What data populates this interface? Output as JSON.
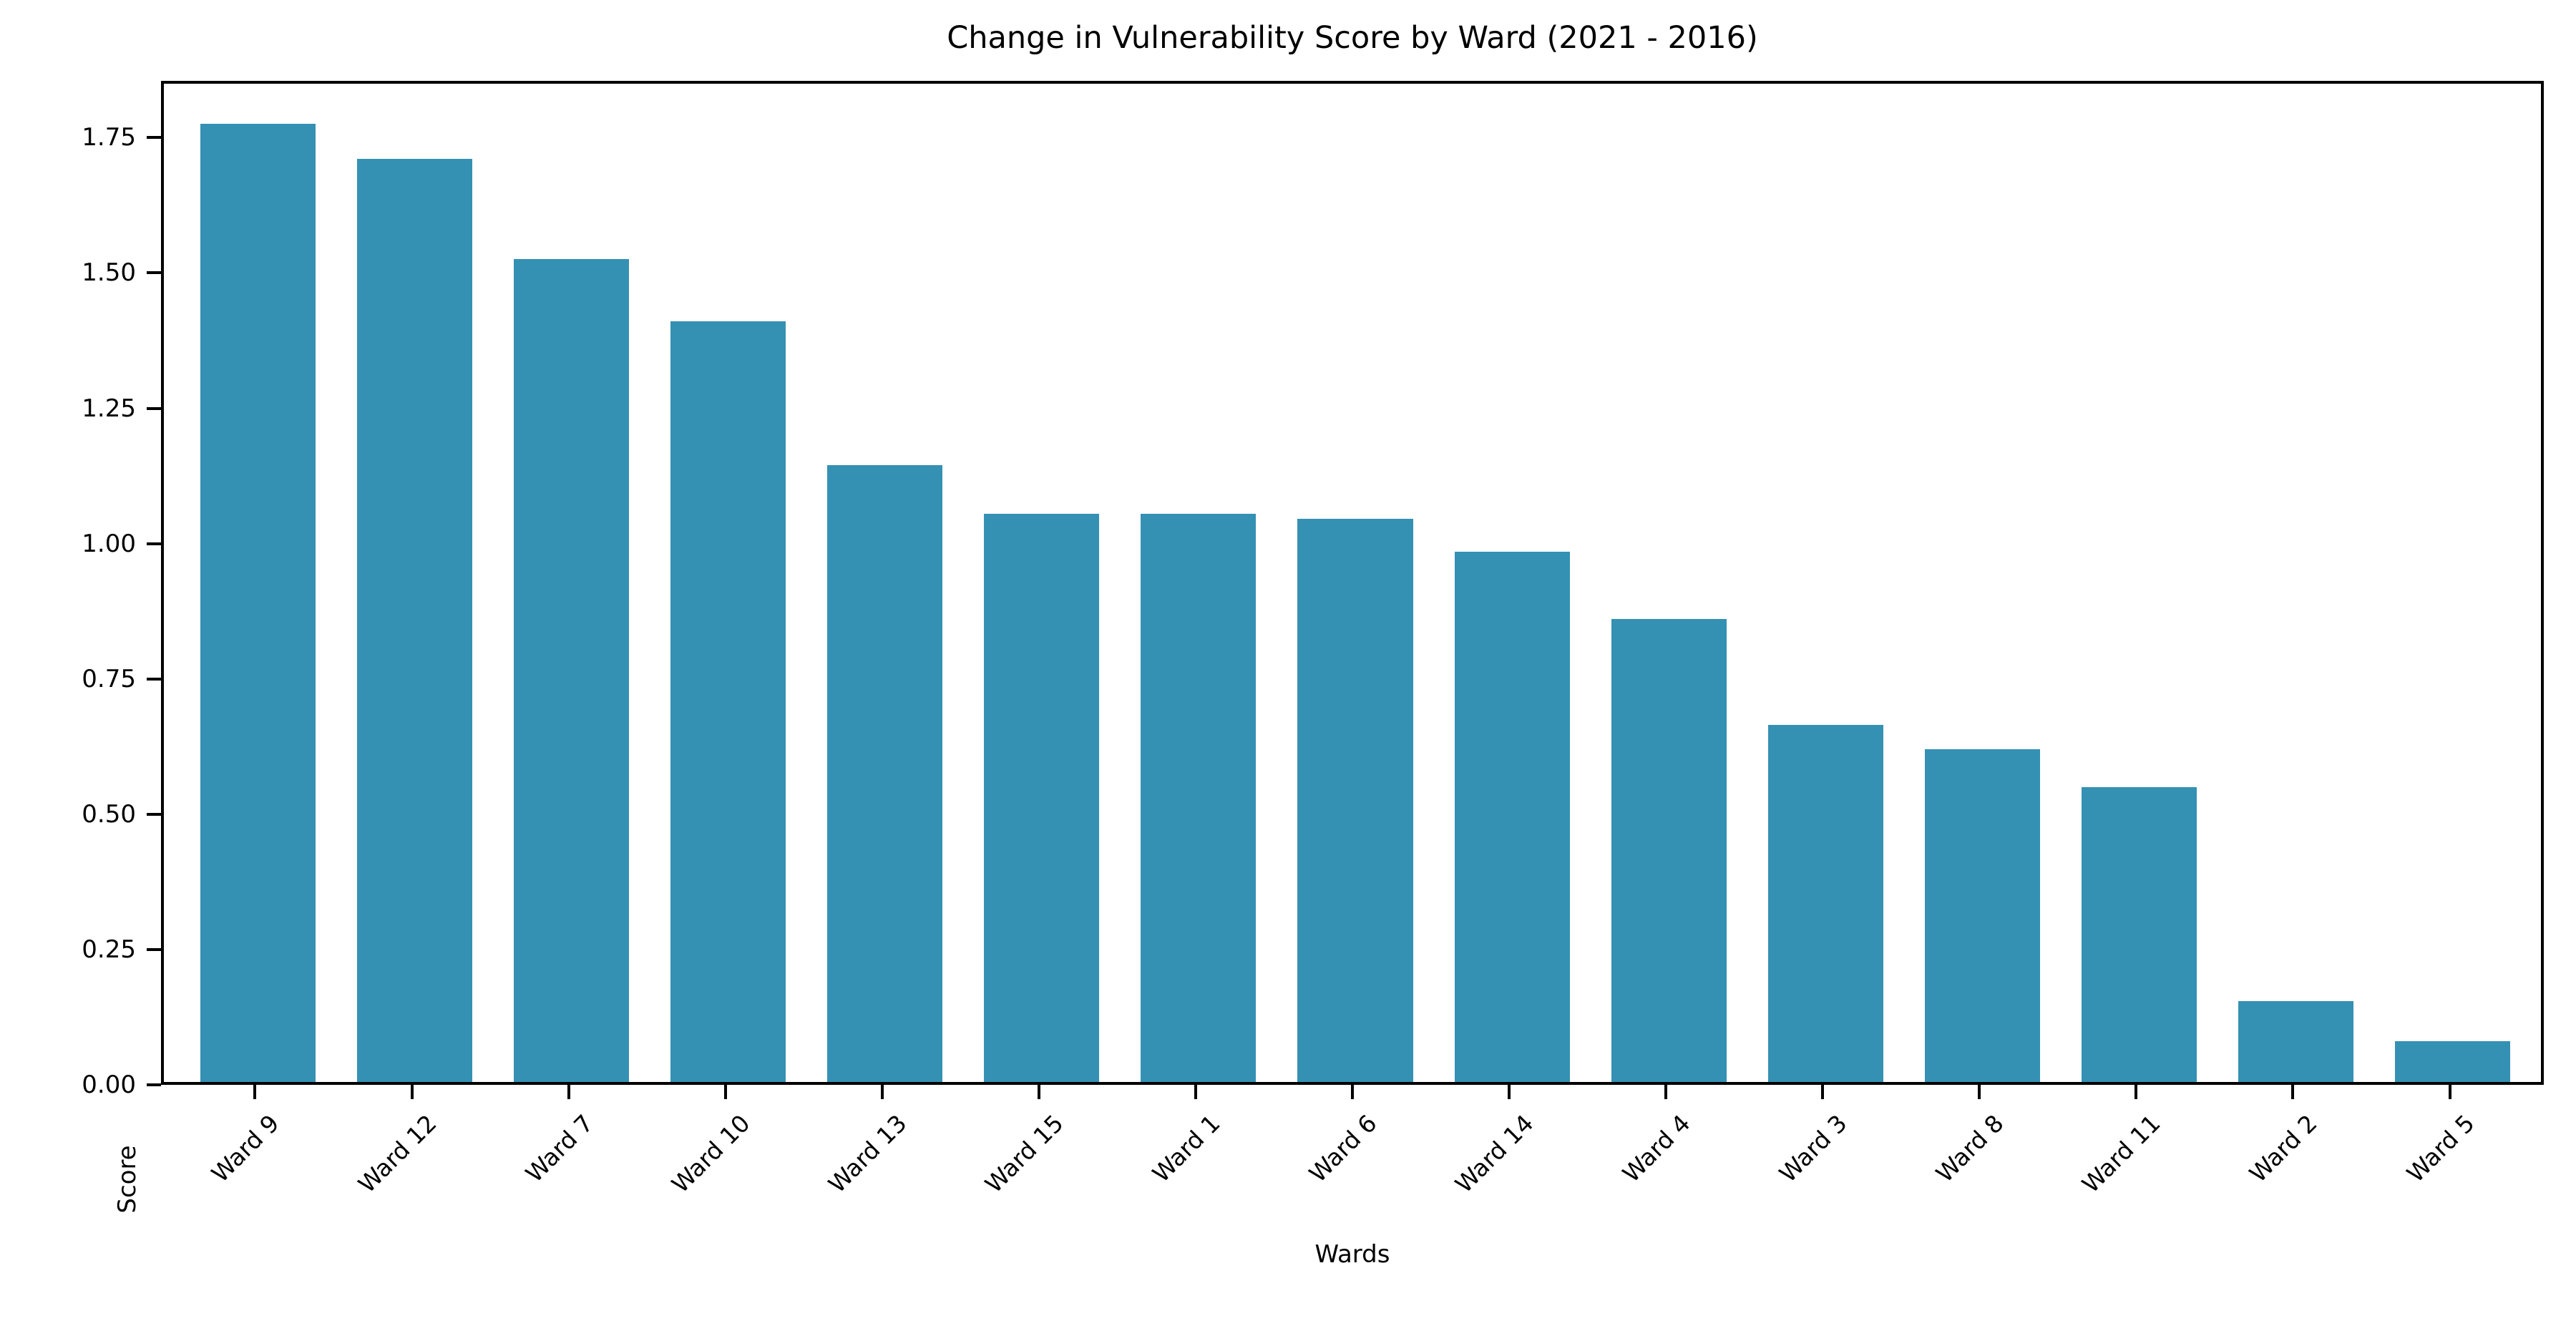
{
  "chart_data": {
    "type": "bar",
    "title": "Change in Vulnerability Score by Ward (2021 - 2016)",
    "xlabel": "Wards",
    "ylabel": "Score",
    "categories": [
      "Ward 9",
      "Ward 12",
      "Ward 7",
      "Ward 10",
      "Ward 13",
      "Ward 15",
      "Ward 1",
      "Ward 6",
      "Ward 14",
      "Ward 4",
      "Ward 3",
      "Ward 8",
      "Ward 11",
      "Ward 2",
      "Ward 5"
    ],
    "values": [
      1.77,
      1.705,
      1.52,
      1.405,
      1.14,
      1.05,
      1.05,
      1.04,
      0.98,
      0.855,
      0.66,
      0.615,
      0.545,
      0.15,
      0.075
    ],
    "ylim": [
      0.0,
      1.855
    ],
    "xlim": [
      -0.6,
      14.6
    ],
    "ytick_labels": [
      "0.00",
      "0.25",
      "0.50",
      "0.75",
      "1.00",
      "1.25",
      "1.50",
      "1.75"
    ],
    "ytick_values": [
      0.0,
      0.25,
      0.5,
      0.75,
      1.0,
      1.25,
      1.5,
      1.75
    ],
    "bar_color": "#3491b3",
    "grid": false,
    "legend": null,
    "xtick_rotation": -45
  }
}
